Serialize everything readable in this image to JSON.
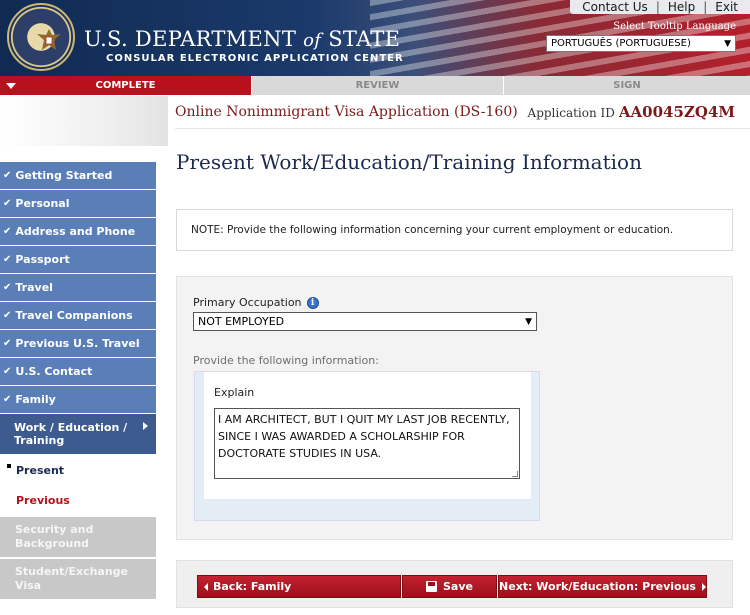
{
  "header": {
    "dept_main": "U.S. DEPARTMENT",
    "dept_of": "of",
    "dept_state": "STATE",
    "subtitle": "CONSULAR ELECTRONIC APPLICATION CENTER",
    "topnav": {
      "contact": "Contact Us",
      "help": "Help",
      "exit": "Exit"
    },
    "language_label": "Select Tooltip Language",
    "language_value": "PORTUGUÊS (PORTUGUESE)"
  },
  "progress": {
    "complete": "COMPLETE",
    "review": "REVIEW",
    "sign": "SIGN"
  },
  "form": {
    "title": "Online Nonimmigrant Visa Application (DS-160)",
    "appid_label": "Application ID",
    "appid_value": "AA0045ZQ4M"
  },
  "sidebar": {
    "items": [
      {
        "label": "Getting Started"
      },
      {
        "label": "Personal"
      },
      {
        "label": "Address and Phone"
      },
      {
        "label": "Passport"
      },
      {
        "label": "Travel"
      },
      {
        "label": "Travel Companions"
      },
      {
        "label": "Previous U.S. Travel"
      },
      {
        "label": "U.S. Contact"
      },
      {
        "label": "Family"
      }
    ],
    "active": "Work / Education / Training",
    "sub_present": "Present",
    "sub_previous": "Previous",
    "security": "Security and Background",
    "student": "Student/Exchange Visa"
  },
  "main": {
    "page_title": "Present Work/Education/Training Information",
    "note": "NOTE: Provide the following information concerning your current employment or education.",
    "occupation_label": "Primary Occupation",
    "occupation_value": "NOT EMPLOYED",
    "provide_label": "Provide the following information:",
    "explain_label": "Explain",
    "explain_text": "I AM ARCHITECT, BUT I QUIT MY LAST JOB RECENTLY, SINCE I WAS AWARDED A SCHOLARSHIP FOR DOCTORATE STUDIES IN USA."
  },
  "buttons": {
    "back": "Back: Family",
    "save": "Save",
    "next": "Next: Work/Education: Previous"
  },
  "colors": {
    "brand_red": "#b7111d",
    "nav_blue": "#5a7fb8",
    "nav_active": "#3d5b8e",
    "title_navy": "#1c2a4e"
  }
}
